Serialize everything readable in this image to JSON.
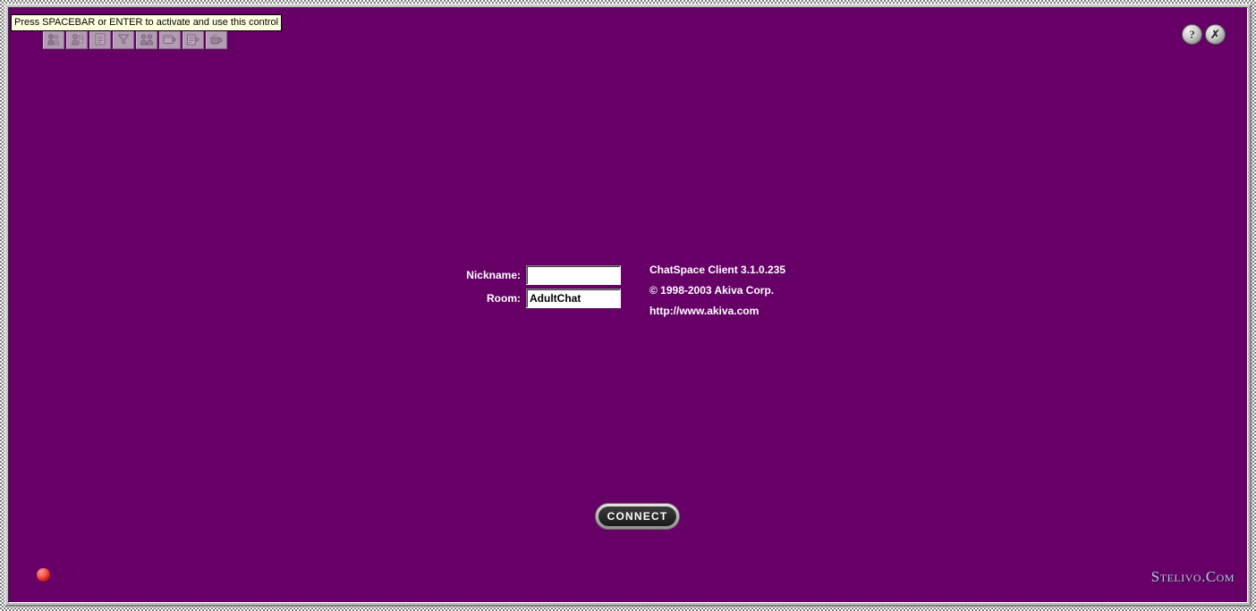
{
  "window": {
    "background_color": "#660066",
    "frame_color": "#c0c0c0"
  },
  "tooltip": {
    "text": "Press SPACEBAR or ENTER to activate and use this control",
    "background_color": "#ffffe1",
    "border_color": "#000000"
  },
  "toolbar": {
    "buttons": [
      {
        "name": "user-list-icon",
        "label": "User List"
      },
      {
        "name": "user-info-icon",
        "label": "User Info"
      },
      {
        "name": "room-list-icon",
        "label": "Room List"
      },
      {
        "name": "filter-icon",
        "label": "Filter"
      },
      {
        "name": "group-icon",
        "label": "Group"
      },
      {
        "name": "new-window-icon",
        "label": "New Window"
      },
      {
        "name": "transcript-icon",
        "label": "Transcript"
      },
      {
        "name": "preferences-icon",
        "label": "Preferences"
      }
    ]
  },
  "titlebar": {
    "buttons": [
      {
        "name": "help-button",
        "glyph": "?",
        "label": "Help"
      },
      {
        "name": "tools-button",
        "glyph": "✗",
        "label": "Tools"
      }
    ]
  },
  "login": {
    "nickname": {
      "label": "Nickname:",
      "value": "",
      "placeholder": ""
    },
    "room": {
      "label": "Room:",
      "value": "AdultChat",
      "placeholder": ""
    }
  },
  "version_info": {
    "lines": [
      "ChatSpace Client 3.1.0.235",
      "© 1998-2003 Akiva Corp.",
      "http://www.akiva.com"
    ]
  },
  "connect": {
    "label": "CONNECT"
  },
  "status": {
    "indicator_color": "#e0392b",
    "indicator_name": "disconnected"
  },
  "watermark": {
    "text": "Stelivo.Com",
    "color": "#b9c7e8"
  }
}
